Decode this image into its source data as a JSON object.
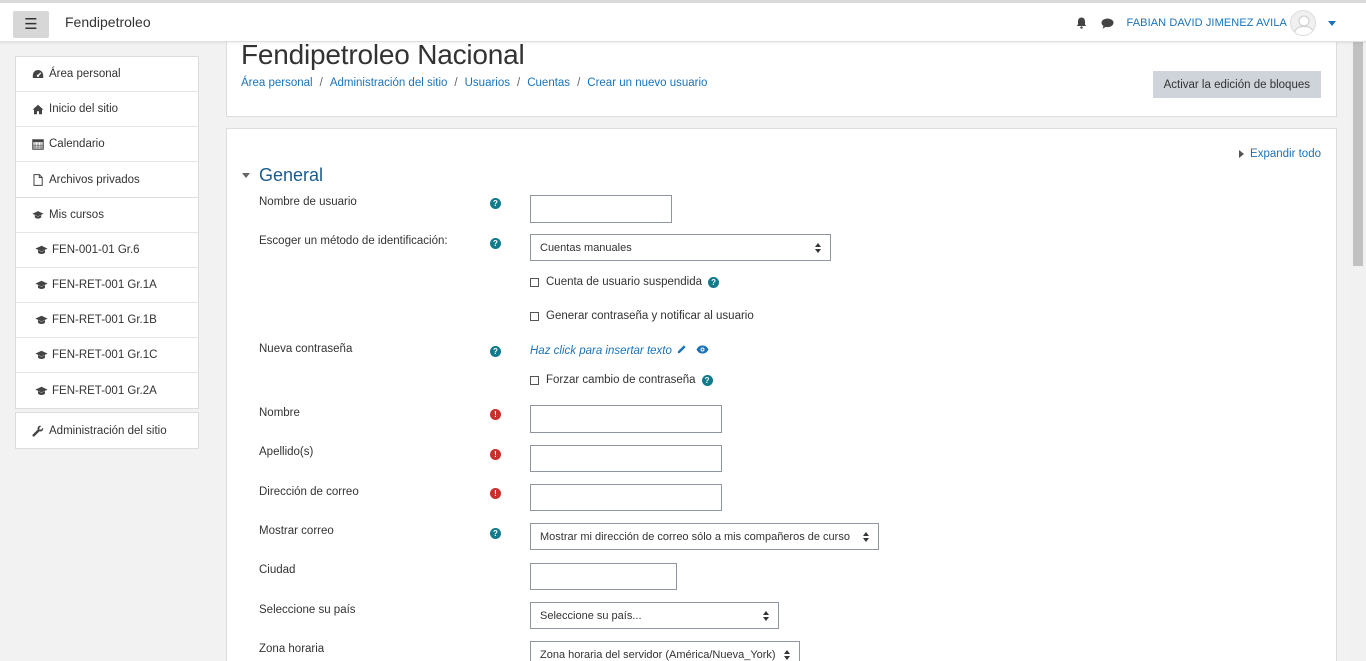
{
  "navbar": {
    "site_name": "Fendipetroleo",
    "user_name": "FABIAN DAVID JIMENEZ AVILA"
  },
  "sidebar": {
    "main_items": [
      {
        "label": "Área personal",
        "icon": "dashboard-icon"
      },
      {
        "label": "Inicio del sitio",
        "icon": "home-icon"
      },
      {
        "label": "Calendario",
        "icon": "calendar-icon"
      },
      {
        "label": "Archivos privados",
        "icon": "file-icon"
      },
      {
        "label": "Mis cursos",
        "icon": "graduation-cap-icon"
      }
    ],
    "courses": [
      {
        "label": "FEN-001-01 Gr.6"
      },
      {
        "label": "FEN-RET-001 Gr.1A"
      },
      {
        "label": "FEN-RET-001 Gr.1B"
      },
      {
        "label": "FEN-RET-001 Gr.1C"
      },
      {
        "label": "FEN-RET-001 Gr.2A"
      }
    ],
    "admin": {
      "label": "Administración del sitio",
      "icon": "wrench-icon"
    }
  },
  "header": {
    "title": "Fendipetroleo Nacional",
    "breadcrumb": [
      "Área personal",
      "Administración del sitio",
      "Usuarios",
      "Cuentas",
      "Crear un nuevo usuario"
    ],
    "edit_blocks_label": "Activar la edición de bloques"
  },
  "form": {
    "expand_all": "Expandir todo",
    "section_title": "General",
    "username_label": "Nombre de usuario",
    "auth_label": "Escoger un método de identificación:",
    "auth_value": "Cuentas manuales",
    "suspended_label": "Cuenta de usuario suspendida",
    "generate_password_label": "Generar contraseña y notificar al usuario",
    "new_password_label": "Nueva contraseña",
    "password_placeholder": "Haz click para insertar texto",
    "force_change_label": "Forzar cambio de contraseña",
    "firstname_label": "Nombre",
    "lastname_label": "Apellido(s)",
    "email_label": "Dirección de correo",
    "show_email_label": "Mostrar correo",
    "show_email_value": "Mostrar mi dirección de correo sólo a mis compañeros de curso",
    "city_label": "Ciudad",
    "country_label": "Seleccione su país",
    "country_value": "Seleccione su país...",
    "timezone_label": "Zona horaria",
    "timezone_value": "Zona horaria del servidor (América/Nueva_York)"
  },
  "colors": {
    "link": "#1a73b8",
    "help": "#117a8b",
    "required": "#c9302c",
    "button_bg": "#ced4da"
  }
}
